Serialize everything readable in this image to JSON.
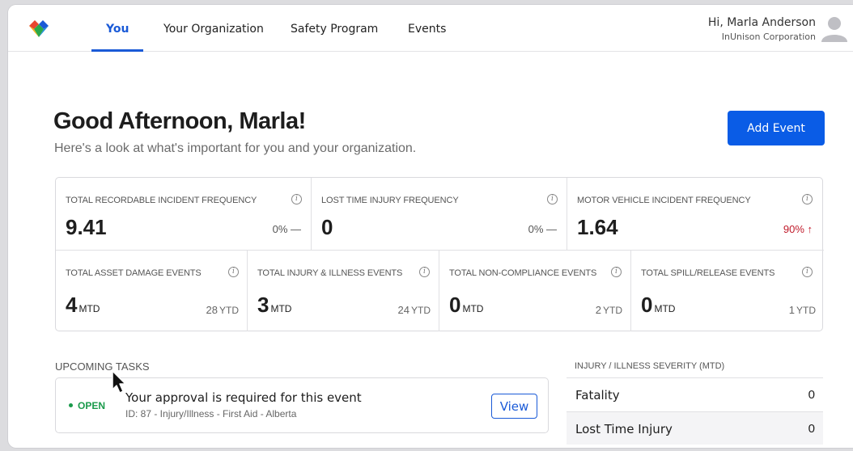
{
  "nav": {
    "tabs": [
      {
        "label": "You",
        "active": true
      },
      {
        "label": "Your Organization"
      },
      {
        "label": "Safety Program"
      },
      {
        "label": "Events"
      }
    ],
    "user_greeting": "Hi, Marla Anderson",
    "user_org": "InUnison Corporation",
    "logo_icon": "brand-logo-icon",
    "avatar_icon": "user-avatar-icon"
  },
  "header": {
    "greeting": "Good Afternoon, Marla!",
    "subtitle": "Here's a look at what's important for you and your organization.",
    "add_event_label": "Add Event"
  },
  "metrics": {
    "row1": [
      {
        "label": "TOTAL RECORDABLE INCIDENT FREQUENCY",
        "value": "9.41",
        "change": "0% —",
        "trend": "flat"
      },
      {
        "label": "LOST TIME INJURY FREQUENCY",
        "value": "0",
        "change": "0% —",
        "trend": "flat"
      },
      {
        "label": "MOTOR VEHICLE INCIDENT FREQUENCY",
        "value": "1.64",
        "change": "90% ↑",
        "trend": "up"
      }
    ],
    "row2": [
      {
        "label": "TOTAL ASSET DAMAGE EVENTS",
        "mtd": "4",
        "ytd": "28"
      },
      {
        "label": "TOTAL INJURY & ILLNESS EVENTS",
        "mtd": "3",
        "ytd": "24"
      },
      {
        "label": "TOTAL NON-COMPLIANCE EVENTS",
        "mtd": "0",
        "ytd": "2"
      },
      {
        "label": "TOTAL SPILL/RELEASE EVENTS",
        "mtd": "0",
        "ytd": "1"
      }
    ],
    "mtd_unit": "MTD",
    "ytd_unit": "YTD",
    "info_glyph": "i"
  },
  "tasks": {
    "title": "UPCOMING TASKS",
    "items": [
      {
        "status": "OPEN",
        "title": "Your approval is required for this event",
        "meta": "ID: 87 - Injury/Illness - First Aid - Alberta",
        "action": "View"
      }
    ]
  },
  "severity": {
    "title": "INJURY / ILLNESS SEVERITY (MTD)",
    "rows": [
      {
        "name": "Fatality",
        "value": "0"
      },
      {
        "name": "Lost Time Injury",
        "value": "0"
      }
    ]
  },
  "colors": {
    "accent": "#1a5ad7",
    "button": "#0a5ce6",
    "open_status": "#1a9a4b",
    "trend_up": "#c01a2a"
  }
}
